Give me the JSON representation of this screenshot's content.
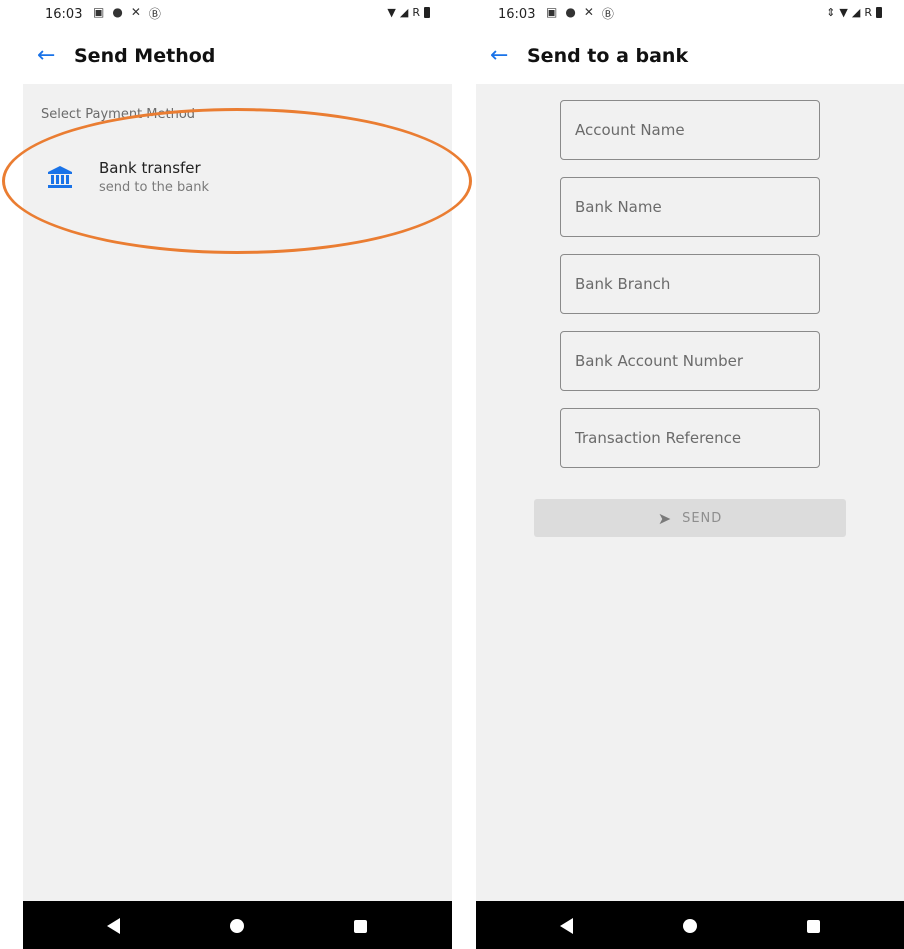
{
  "left_screen": {
    "status_time": "16:03",
    "status_icons": [
      "image-icon",
      "chat-icon",
      "missed-call-icon",
      "b-badge-icon",
      "wifi-icon",
      "signal-icon",
      "roaming-r",
      "battery-icon"
    ],
    "roaming": "R",
    "title": "Send Method",
    "section_label": "Select Payment Method",
    "methods": [
      {
        "icon": "bank-icon",
        "title": "Bank transfer",
        "subtitle": "send to the bank"
      }
    ]
  },
  "right_screen": {
    "status_time": "16:03",
    "status_icons": [
      "image-icon",
      "chat-icon",
      "missed-call-icon",
      "b-badge-icon",
      "data-arrows-icon",
      "wifi-icon",
      "signal-icon",
      "roaming-r",
      "battery-icon"
    ],
    "roaming": "R",
    "title": "Send to a bank",
    "fields": [
      {
        "placeholder": "Account Name",
        "value": ""
      },
      {
        "placeholder": "Bank Name",
        "value": ""
      },
      {
        "placeholder": "Bank Branch",
        "value": ""
      },
      {
        "placeholder": "Bank Account Number",
        "value": ""
      },
      {
        "placeholder": "Transaction Reference",
        "value": ""
      }
    ],
    "send_label": "SEND",
    "send_enabled": false
  },
  "colors": {
    "accent": "#1a73e8",
    "highlight": "#ea7d32",
    "content_bg": "#f1f1f1",
    "button_disabled_bg": "#dcdcdc",
    "navbar_bg": "#000000"
  }
}
